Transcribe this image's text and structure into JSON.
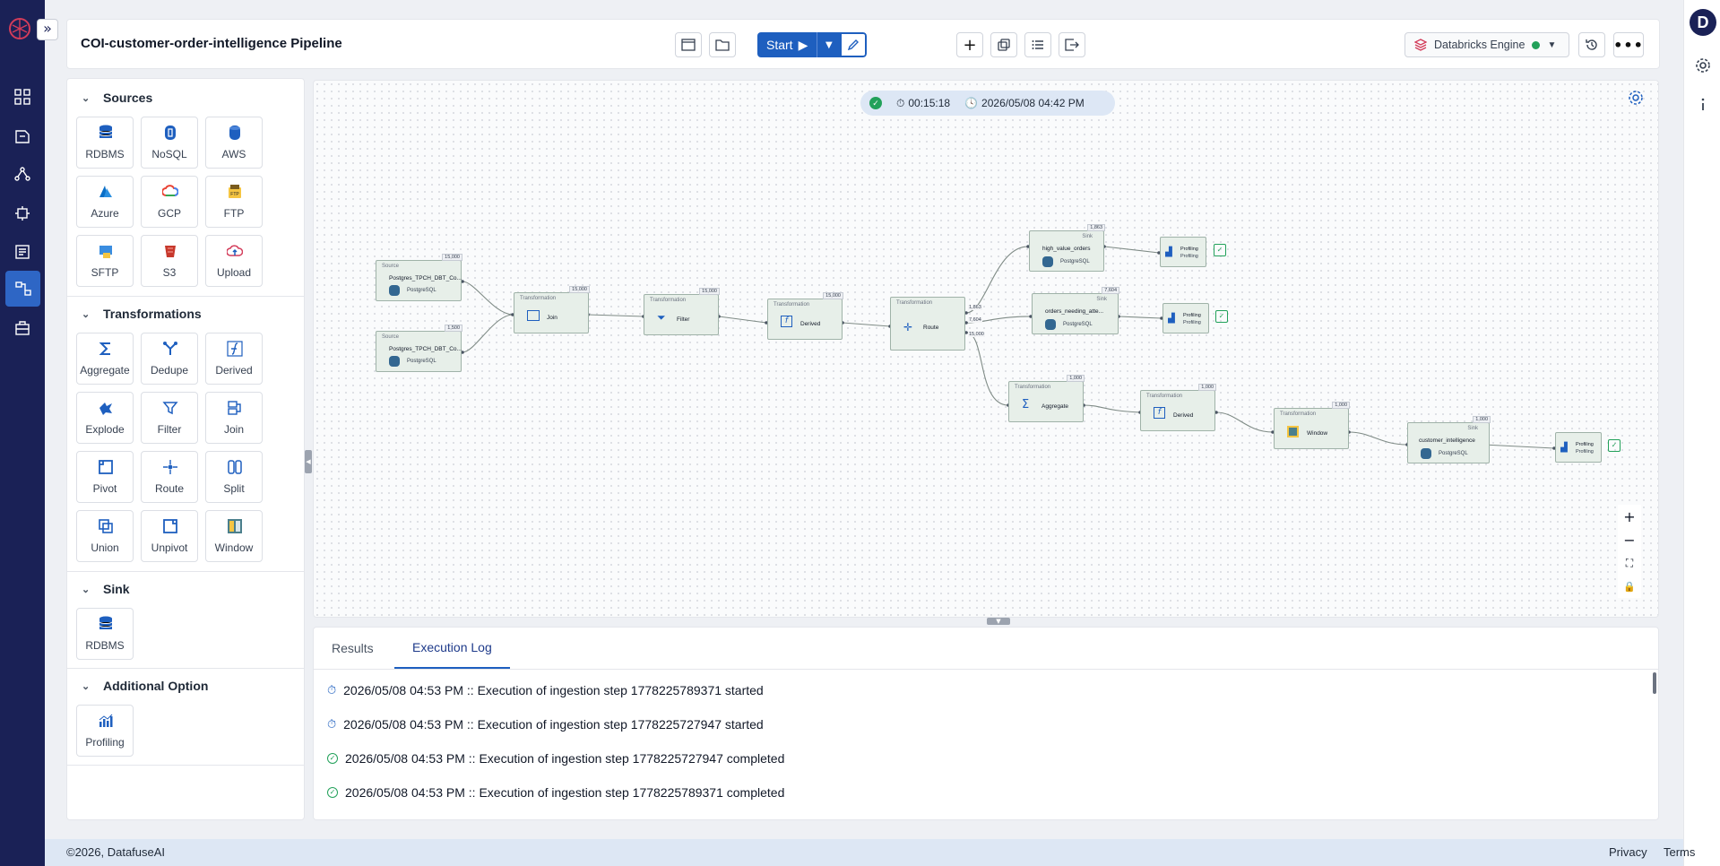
{
  "pipeline": {
    "title": "COI-customer-order-intelligence Pipeline"
  },
  "toolbar": {
    "start_label": "Start",
    "engine_label": "Databricks Engine",
    "engine_status_color": "#22a15a"
  },
  "user": {
    "initial": "D"
  },
  "palette": {
    "sources": {
      "title": "Sources",
      "items": [
        "RDBMS",
        "NoSQL",
        "AWS",
        "Azure",
        "GCP",
        "FTP",
        "SFTP",
        "S3",
        "Upload"
      ]
    },
    "transformations": {
      "title": "Transformations",
      "items": [
        "Aggregate",
        "Dedupe",
        "Derived",
        "Explode",
        "Filter",
        "Join",
        "Pivot",
        "Route",
        "Split",
        "Union",
        "Unpivot",
        "Window"
      ]
    },
    "sink": {
      "title": "Sink",
      "items": [
        "RDBMS"
      ]
    },
    "additional": {
      "title": "Additional Option",
      "items": [
        "Profiling"
      ]
    }
  },
  "run": {
    "duration": "00:15:18",
    "timestamp": "2026/05/08 04:42 PM"
  },
  "nodes": {
    "src1": {
      "kind": "Source",
      "name": "Postgres_TPCH_DBT_Co...",
      "sub": "PostgreSQL",
      "count": "15,000"
    },
    "src2": {
      "kind": "Source",
      "name": "Postgres_TPCH_DBT_Co...",
      "sub": "PostgreSQL",
      "count": "1,500"
    },
    "join": {
      "kind": "Transformation",
      "name": "Join",
      "count": "15,000"
    },
    "filter": {
      "kind": "Transformation",
      "name": "Filter",
      "count": "15,000"
    },
    "derived1": {
      "kind": "Transformation",
      "name": "Derived",
      "count": "15,000"
    },
    "route": {
      "kind": "Transformation",
      "name": "Route"
    },
    "sink_hv": {
      "kind": "Sink",
      "name": "high_value_orders",
      "sub": "PostgreSQL",
      "count": "1,863"
    },
    "sink_ona": {
      "kind": "Sink",
      "name": "orders_needing_atte...",
      "sub": "PostgreSQL",
      "count": "7,604"
    },
    "prof1": {
      "name": "Profiling",
      "sub": "Profiling"
    },
    "prof2": {
      "name": "Profiling",
      "sub": "Profiling"
    },
    "aggregate": {
      "kind": "Transformation",
      "name": "Aggregate",
      "count": "1,000"
    },
    "derived2": {
      "kind": "Transformation",
      "name": "Derived",
      "count": "1,000"
    },
    "window": {
      "kind": "Transformation",
      "name": "Window",
      "count": "1,000"
    },
    "sink_ci": {
      "kind": "Sink",
      "name": "customer_intelligence",
      "sub": "PostgreSQL",
      "count": "1,000"
    },
    "prof3": {
      "name": "Profiling",
      "sub": "Profiling"
    }
  },
  "edge_labels": {
    "route_out1": "1,863",
    "route_out2": "7,604",
    "route_out3": "15,000"
  },
  "bottom": {
    "tabs": [
      "Results",
      "Execution Log"
    ],
    "active_tab": "Execution Log",
    "logs": [
      {
        "status": "started",
        "text": "2026/05/08 04:53 PM :: Execution of ingestion step 1778225789371 started"
      },
      {
        "status": "started",
        "text": "2026/05/08 04:53 PM :: Execution of ingestion step 1778225727947 started"
      },
      {
        "status": "completed",
        "text": "2026/05/08 04:53 PM :: Execution of ingestion step 1778225727947 completed"
      },
      {
        "status": "completed",
        "text": "2026/05/08 04:53 PM :: Execution of ingestion step 1778225789371 completed"
      }
    ]
  },
  "footer": {
    "copyright": "©2026, DatafuseAI",
    "privacy": "Privacy",
    "terms": "Terms"
  },
  "colors": {
    "nav_bg": "#1a2156",
    "accent": "#1e5fbf",
    "success": "#22a15a",
    "brand_red": "#d33c5a"
  }
}
